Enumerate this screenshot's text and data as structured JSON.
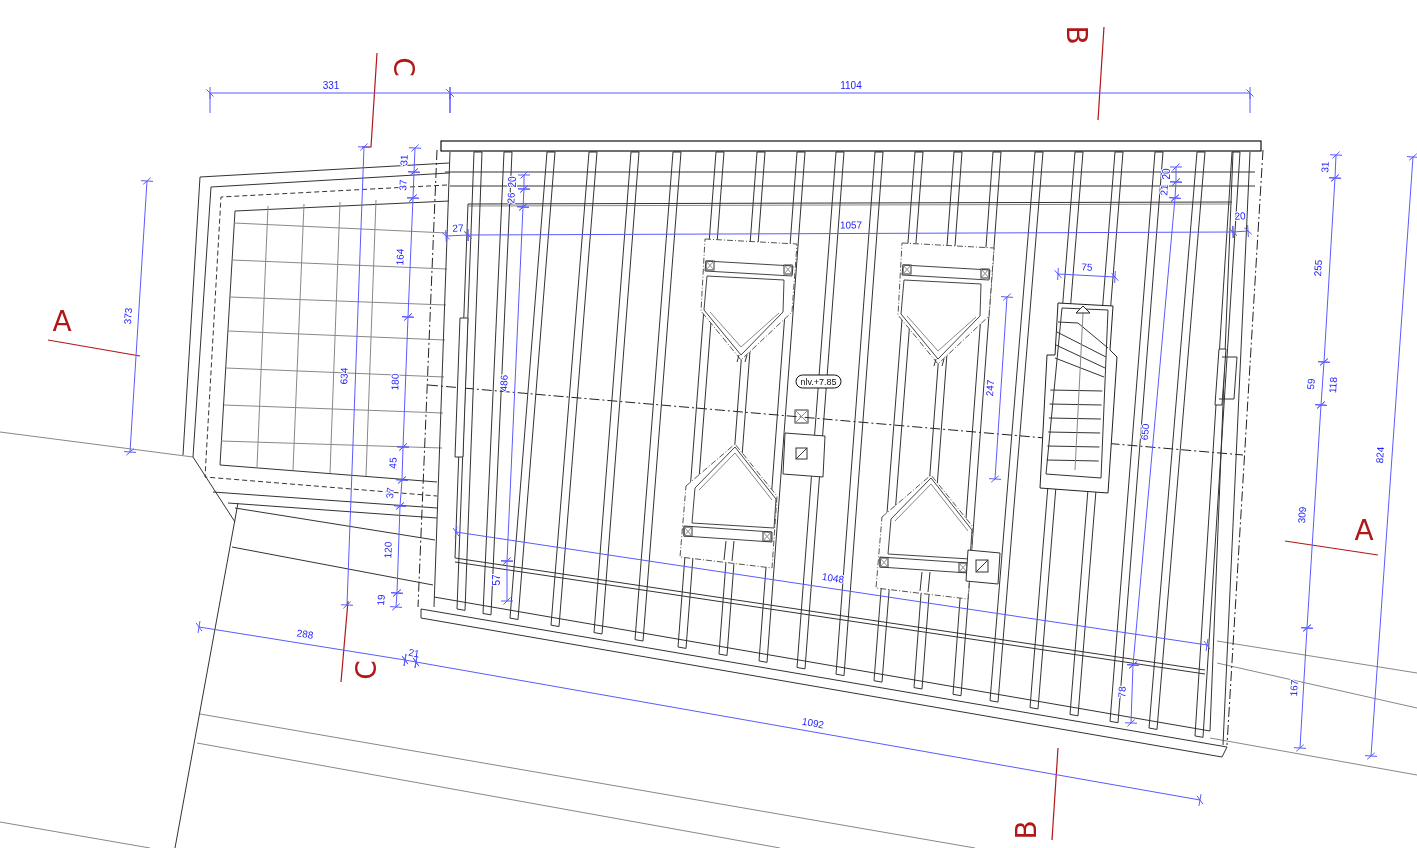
{
  "drawing": {
    "section_markers": [
      {
        "letter": "B"
      },
      {
        "letter": "C"
      },
      {
        "letter": "A"
      },
      {
        "letter": "A"
      },
      {
        "letter": "C"
      },
      {
        "letter": "B"
      }
    ],
    "dimension_labels": [
      "331",
      "1104",
      "31",
      "37",
      "20",
      "26",
      "20",
      "21",
      "31",
      "27",
      "1057",
      "20",
      "164",
      "255",
      "75",
      "373",
      "634",
      "180",
      "486",
      "247",
      "650",
      "59",
      "118",
      "824",
      "45",
      "37",
      "309",
      "120",
      "1048",
      "57",
      "19",
      "288",
      "21",
      "167",
      "78",
      "1092"
    ],
    "level_tag": "nlv.+7.85"
  }
}
